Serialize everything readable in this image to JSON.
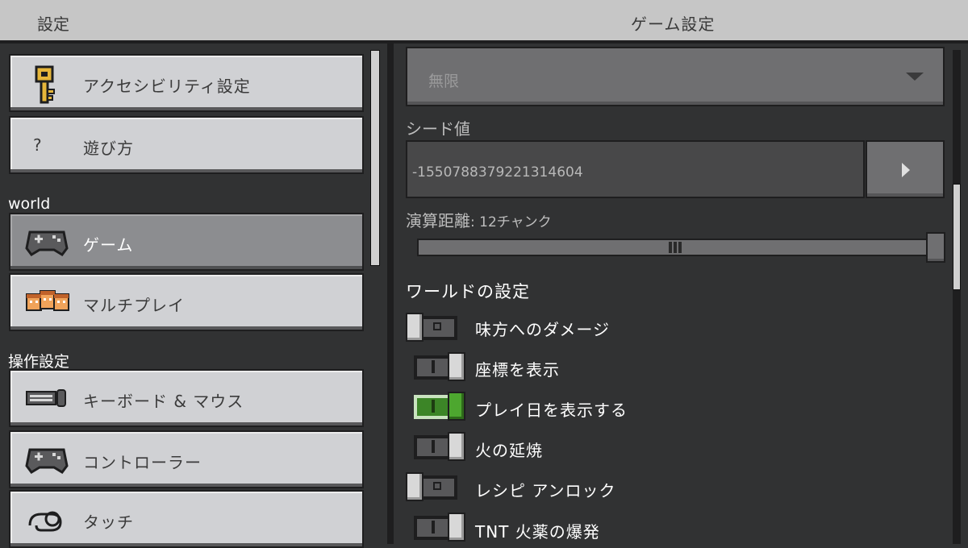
{
  "header": {
    "left_title": "設定",
    "right_title": "ゲーム設定"
  },
  "sidebar": {
    "groups": [
      {
        "label": "",
        "items": [
          {
            "label": "アクセシビリティ設定",
            "icon": "key-icon"
          },
          {
            "label": "遊び方",
            "icon": "question-icon"
          }
        ]
      },
      {
        "label": "world",
        "items": [
          {
            "label": "ゲーム",
            "icon": "gamepad-icon",
            "selected": true
          },
          {
            "label": "マルチプレイ",
            "icon": "players-icon"
          }
        ]
      },
      {
        "label": "操作設定",
        "items": [
          {
            "label": "キーボード & マウス",
            "icon": "keyboard-mouse-icon"
          },
          {
            "label": "コントローラー",
            "icon": "controller-icon"
          },
          {
            "label": "タッチ",
            "icon": "touch-icon"
          }
        ]
      }
    ]
  },
  "main": {
    "dropdown_value": "無限",
    "seed_label": "シード値",
    "seed_value": "-1550788379221314604",
    "sim_distance_label": "演算距離",
    "sim_distance_value": ": 12チャンク",
    "sim_distance_slider_fraction": 1.0,
    "world_settings_header": "ワールドの設定",
    "toggles": [
      {
        "label": "味方へのダメージ",
        "state": "off"
      },
      {
        "label": "座標を表示",
        "state": "on"
      },
      {
        "label": "プレイ日を表示する",
        "state": "on-green"
      },
      {
        "label": "火の延焼",
        "state": "on"
      },
      {
        "label": "レシピ アンロック",
        "state": "off"
      },
      {
        "label": "TNT 火薬の爆発",
        "state": "on"
      }
    ]
  },
  "colors": {
    "panel_bg": "#313233",
    "button_bg": "#d0d1d4",
    "selected_bg": "#8c8d90",
    "toggle_green": "#4da72f"
  }
}
